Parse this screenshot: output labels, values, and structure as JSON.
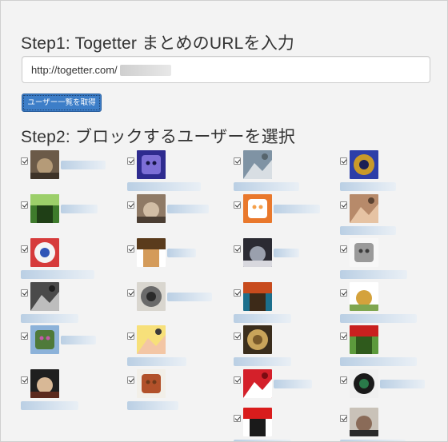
{
  "step1": {
    "title": "Step1: Togetter まとめのURLを入力",
    "url_value": "http://togetter.com/",
    "fetch_button_label": "ユーザー一覧を取得"
  },
  "step2": {
    "title": "Step2: ブロックするユーザーを選択",
    "users": [
      {
        "checked": true,
        "avatar_icon": "cat-photo-icon",
        "colors": [
          "#6b5a48",
          "#b59b78",
          "#3e3328"
        ]
      },
      {
        "checked": true,
        "avatar_icon": "anime-character-icon",
        "colors": [
          "#2e2b8f",
          "#7d6fd6",
          "#151443"
        ]
      },
      {
        "checked": true,
        "avatar_icon": "canal-photo-icon",
        "colors": [
          "#7f93a4",
          "#d8dee3",
          "#56646c"
        ]
      },
      {
        "checked": true,
        "avatar_icon": "sonic-character-icon",
        "colors": [
          "#2d3fa8",
          "#c99a2a",
          "#1a1f55"
        ]
      },
      {
        "checked": true,
        "avatar_icon": "plant-photo-icon",
        "colors": [
          "#3e7b2c",
          "#9ccf6a",
          "#1f3f16"
        ]
      },
      {
        "checked": true,
        "avatar_icon": "cat-photo-icon",
        "colors": [
          "#8f7a66",
          "#d1bda5",
          "#4b3e33"
        ]
      },
      {
        "checked": true,
        "avatar_icon": "hello-kitty-icon",
        "colors": [
          "#e9782c",
          "#ffffff",
          "#f5a04b"
        ]
      },
      {
        "checked": true,
        "avatar_icon": "baby-photo-icon",
        "colors": [
          "#b78a6a",
          "#e6c3a3",
          "#5a4231"
        ]
      },
      {
        "checked": true,
        "avatar_icon": "anime-character-icon",
        "colors": [
          "#d63b3b",
          "#f4f4f4",
          "#2f55b7"
        ]
      },
      {
        "checked": true,
        "avatar_icon": "bear-character-icon",
        "colors": [
          "#ffffff",
          "#5a3b1c",
          "#d49b5a"
        ]
      },
      {
        "checked": true,
        "avatar_icon": "anime-character-icon",
        "colors": [
          "#2b2b33",
          "#9aa0ad",
          "#d8d8de"
        ]
      },
      {
        "checked": true,
        "avatar_icon": "wing-illustration-icon",
        "colors": [
          "#f7f7f7",
          "#9a9a9a",
          "#3c3c3c"
        ]
      },
      {
        "checked": true,
        "avatar_icon": "cat-photo-icon",
        "colors": [
          "#4a4a4a",
          "#bdbdbd",
          "#1f1f1f"
        ]
      },
      {
        "checked": true,
        "avatar_icon": "manga-face-icon",
        "colors": [
          "#d9d6cf",
          "#6a6a6a",
          "#2a2a2a"
        ]
      },
      {
        "checked": true,
        "avatar_icon": "robot-illustration-icon",
        "colors": [
          "#1c6f8c",
          "#c84b1d",
          "#3d2a18"
        ]
      },
      {
        "checked": true,
        "avatar_icon": "sushi-logo-icon",
        "colors": [
          "#ffffff",
          "#d4a23c",
          "#7fa650"
        ]
      },
      {
        "checked": true,
        "avatar_icon": "landscape-photo-icon",
        "colors": [
          "#8cb2d9",
          "#4f7a3a",
          "#c45aa8"
        ]
      },
      {
        "checked": true,
        "avatar_icon": "anime-character-icon",
        "colors": [
          "#f7e07a",
          "#f3c6a5",
          "#3a3a3a"
        ]
      },
      {
        "checked": true,
        "avatar_icon": "gold-object-icon",
        "colors": [
          "#3a2d1c",
          "#c9a45a",
          "#7a5a2a"
        ]
      },
      {
        "checked": true,
        "avatar_icon": "car-photo-icon",
        "colors": [
          "#5c9a3c",
          "#c8201f",
          "#2f5a1c"
        ]
      },
      {
        "checked": true,
        "avatar_icon": "anime-character-icon",
        "colors": [
          "#1f1f1f",
          "#d8b896",
          "#5b2a1e"
        ]
      },
      {
        "checked": true,
        "avatar_icon": "ramen-photo-icon",
        "colors": [
          "#f2efe8",
          "#b2512a",
          "#6f3a1a"
        ]
      },
      {
        "checked": true,
        "avatar_icon": "skull-pirate-icon",
        "colors": [
          "#d4202a",
          "#ffffff",
          "#7a0c12"
        ]
      },
      {
        "checked": true,
        "avatar_icon": "pirate-character-icon",
        "colors": [
          "#f0f0f0",
          "#1a1a1a",
          "#2a7a4a"
        ]
      },
      {
        "checked": true,
        "avatar_icon": "daruma-icon",
        "colors": [
          "#ffffff",
          "#d91c1c",
          "#1a1a1a"
        ]
      },
      {
        "checked": true,
        "avatar_icon": "portrait-photo-icon",
        "colors": [
          "#c9c2b8",
          "#8a6b58",
          "#2a2a2a"
        ]
      }
    ]
  }
}
